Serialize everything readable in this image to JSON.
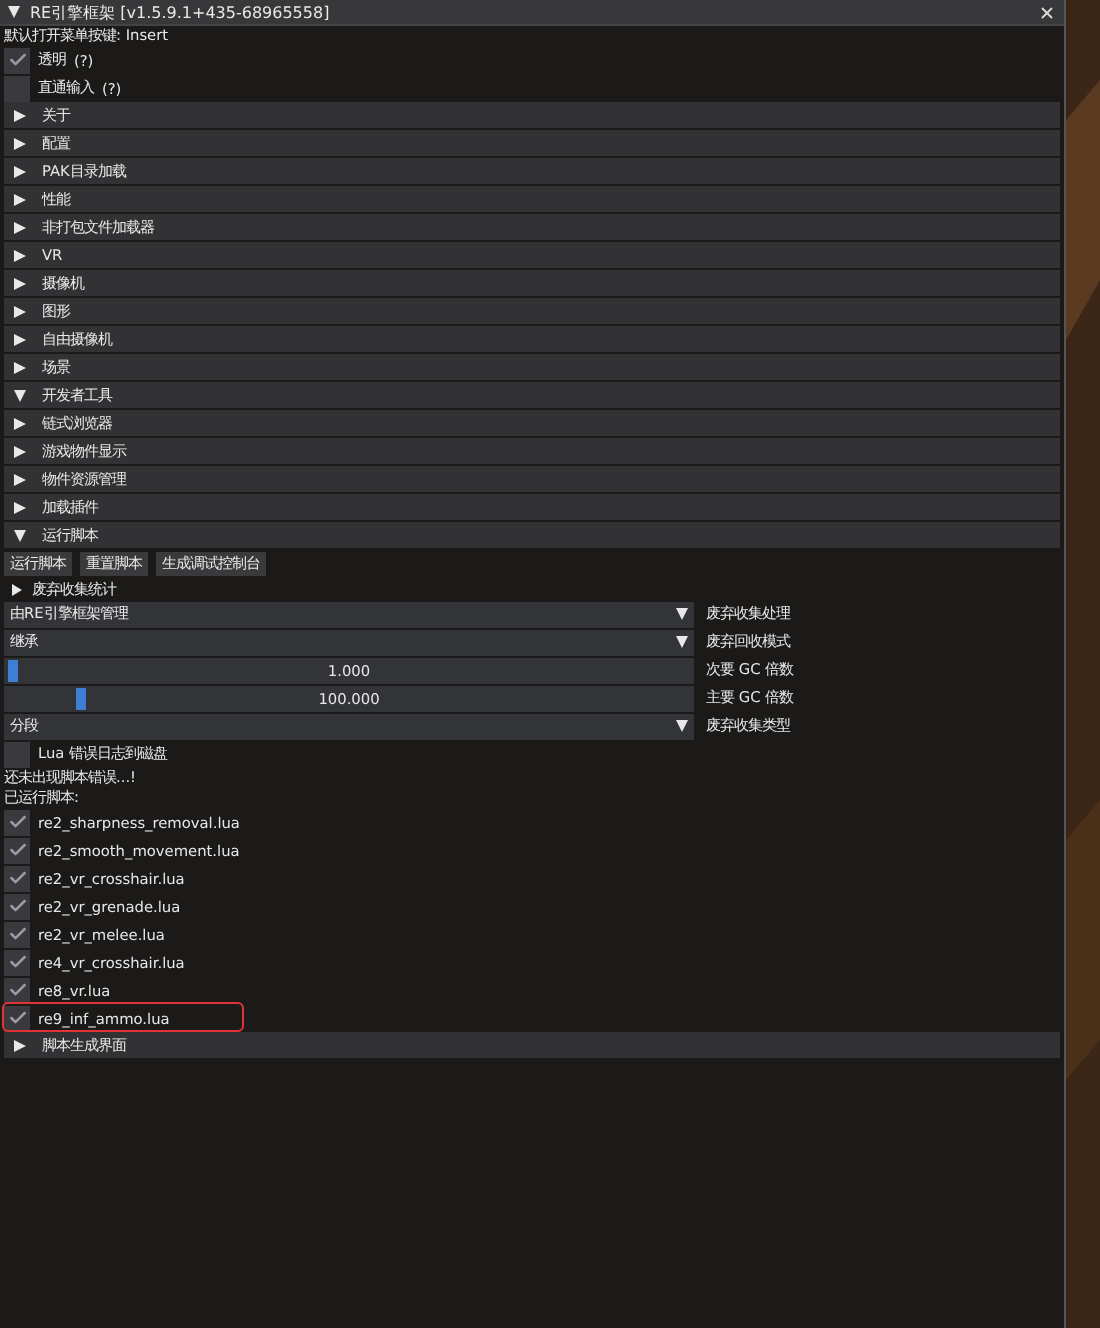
{
  "window": {
    "title": "RE引擎框架 [v1.5.9.1+435-68965558]",
    "expanded": true
  },
  "hint": "默认打开菜单按键: Insert",
  "options": [
    {
      "label": "透明",
      "help": "(?)",
      "checked": true
    },
    {
      "label": "直通输入",
      "help": "(?)",
      "checked": false
    }
  ],
  "sections": [
    {
      "label": "关于",
      "expanded": false
    },
    {
      "label": "配置",
      "expanded": false
    },
    {
      "label": "PAK目录加载",
      "expanded": false
    },
    {
      "label": "性能",
      "expanded": false
    },
    {
      "label": "非打包文件加载器",
      "expanded": false
    },
    {
      "label": "VR",
      "expanded": false
    },
    {
      "label": "摄像机",
      "expanded": false
    },
    {
      "label": "图形",
      "expanded": false
    },
    {
      "label": "自由摄像机",
      "expanded": false
    },
    {
      "label": "场景",
      "expanded": false
    },
    {
      "label": "开发者工具",
      "expanded": true
    },
    {
      "label": "链式浏览器",
      "expanded": false
    },
    {
      "label": "游戏物件显示",
      "expanded": false
    },
    {
      "label": "物件资源管理",
      "expanded": false
    },
    {
      "label": "加载插件",
      "expanded": false
    },
    {
      "label": "运行脚本",
      "expanded": true
    }
  ],
  "script_panel": {
    "buttons": [
      "运行脚本",
      "重置脚本",
      "生成调试控制台"
    ],
    "gc_stats": {
      "label": "废弃收集统计",
      "expanded": false
    },
    "controls": [
      {
        "kind": "combo",
        "value": "由RE引擎框架管理",
        "label": "废弃收集处理"
      },
      {
        "kind": "combo",
        "value": "继承",
        "label": "废弃回收模式"
      },
      {
        "kind": "slider",
        "value": "1.000",
        "level": 0.0,
        "label": "次要 GC 倍数"
      },
      {
        "kind": "slider",
        "value": "100.000",
        "level": 0.1,
        "label": "主要 GC 倍数"
      },
      {
        "kind": "combo",
        "value": "分段",
        "label": "废弃收集类型"
      }
    ],
    "log_option": {
      "label": "Lua 错误日志到磁盘",
      "checked": false
    },
    "status": "还未出现脚本错误...!",
    "loaded_heading": "已运行脚本:",
    "scripts": [
      {
        "name": "re2_sharpness_removal.lua",
        "checked": true
      },
      {
        "name": "re2_smooth_movement.lua",
        "checked": true
      },
      {
        "name": "re2_vr_crosshair.lua",
        "checked": true
      },
      {
        "name": "re2_vr_grenade.lua",
        "checked": true
      },
      {
        "name": "re2_vr_melee.lua",
        "checked": true
      },
      {
        "name": "re4_vr_crosshair.lua",
        "checked": true
      },
      {
        "name": "re8_vr.lua",
        "checked": true
      },
      {
        "name": "re9_inf_ammo.lua",
        "checked": true
      }
    ],
    "footer_section": {
      "label": "脚本生成界面",
      "expanded": false
    }
  }
}
